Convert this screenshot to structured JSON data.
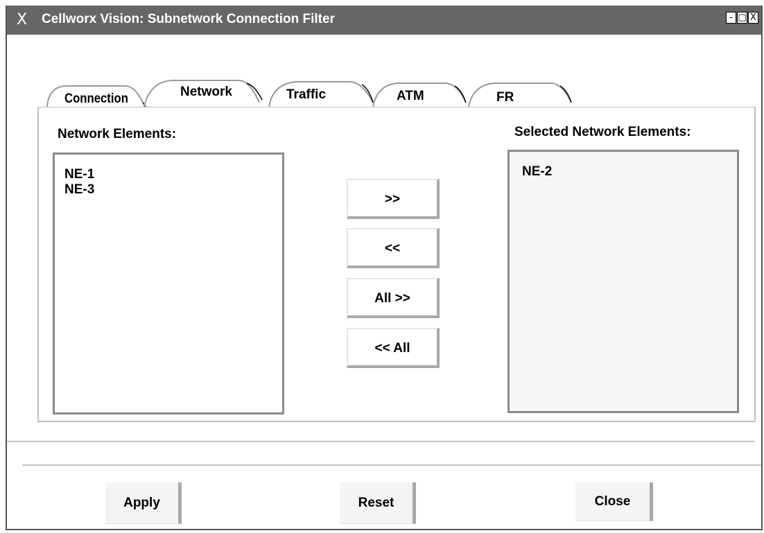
{
  "window": {
    "title": "Cellworx Vision: Subnetwork Connection Filter",
    "x_logo": "X",
    "controls": {
      "minimize": "-",
      "maximize": "□",
      "close": "X"
    }
  },
  "tabs": [
    {
      "label": "Connection",
      "active": false
    },
    {
      "label": "Network",
      "active": true
    },
    {
      "label": "Traffic",
      "active": false
    },
    {
      "label": "ATM",
      "active": false
    },
    {
      "label": "FR",
      "active": false
    }
  ],
  "left_list": {
    "label": "Network Elements:",
    "items": [
      "NE-1",
      "NE-3"
    ]
  },
  "right_list": {
    "label": "Selected Network Elements:",
    "items": [
      "NE-2"
    ]
  },
  "move_buttons": {
    "add": ">>",
    "remove": "<<",
    "add_all": "All >>",
    "remove_all": "<< All"
  },
  "footer": {
    "apply": "Apply",
    "reset": "Reset",
    "close": "Close"
  }
}
